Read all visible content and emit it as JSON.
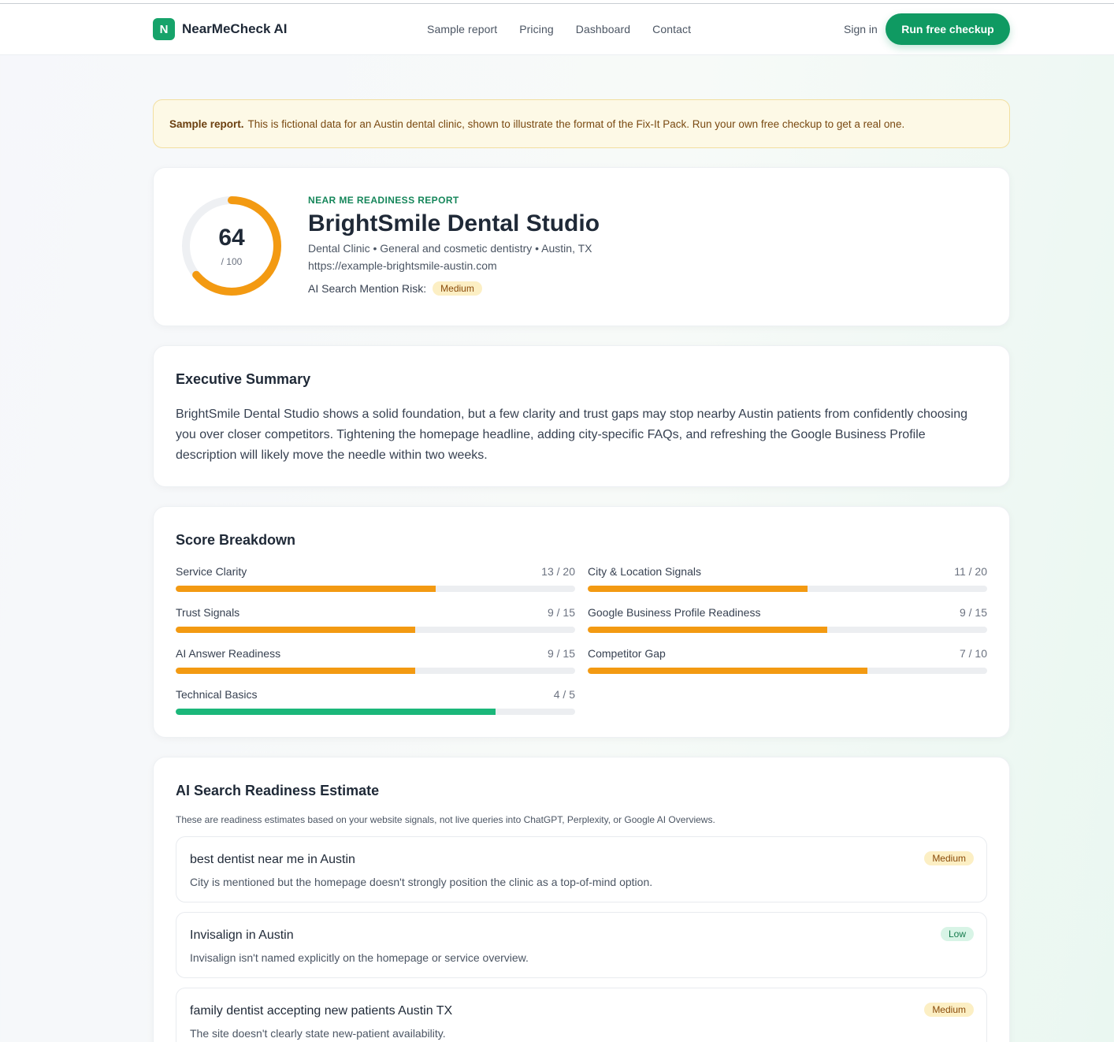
{
  "app": {
    "logo_letter": "N",
    "brand": "NearMeCheck AI"
  },
  "nav": {
    "items": [
      "Sample report",
      "Pricing",
      "Dashboard",
      "Contact"
    ],
    "signin": "Sign in",
    "cta": "Run free checkup"
  },
  "banner": {
    "strong": "Sample report.",
    "text": "This is fictional data for an Austin dental clinic, shown to illustrate the format of the Fix-It Pack. Run your own free checkup to get a real one."
  },
  "report": {
    "score": 64,
    "score_display": "64",
    "score_max": "/ 100",
    "eyebrow": "NEAR ME READINESS REPORT",
    "business_name": "BrightSmile Dental Studio",
    "meta": "Dental Clinic • General and cosmetic dentistry • Austin, TX",
    "url": "https://example-brightsmile-austin.com",
    "risk_label": "AI Search Mention Risk:",
    "risk_value": "Medium"
  },
  "summary": {
    "title": "Executive Summary",
    "text": "BrightSmile Dental Studio shows a solid foundation, but a few clarity and trust gaps may stop nearby Austin patients from confidently choosing you over closer competitors. Tightening the homepage headline, adding city-specific FAQs, and refreshing the Google Business Profile description will likely move the needle within two weeks."
  },
  "breakdown": {
    "title": "Score Breakdown",
    "metrics": [
      {
        "label": "Service Clarity",
        "value": "13 / 20",
        "score": 13,
        "max": 20
      },
      {
        "label": "City & Location Signals",
        "value": "11 / 20",
        "score": 11,
        "max": 20
      },
      {
        "label": "Trust Signals",
        "value": "9 / 15",
        "score": 9,
        "max": 15
      },
      {
        "label": "Google Business Profile Readiness",
        "value": "9 / 15",
        "score": 9,
        "max": 15
      },
      {
        "label": "AI Answer Readiness",
        "value": "9 / 15",
        "score": 9,
        "max": 15
      },
      {
        "label": "Competitor Gap",
        "value": "7 / 10",
        "score": 7,
        "max": 10
      },
      {
        "label": "Technical Basics",
        "value": "4 / 5",
        "score": 4,
        "max": 5
      }
    ]
  },
  "ai_search": {
    "title": "AI Search Readiness Estimate",
    "note": "These are readiness estimates based on your website signals, not live queries into ChatGPT, Perplexity, or Google AI Overviews.",
    "queries": [
      {
        "query": "best dentist near me in Austin",
        "desc": "City is mentioned but the homepage doesn't strongly position the clinic as a top-of-mind option.",
        "level": "Medium"
      },
      {
        "query": "Invisalign in Austin",
        "desc": "Invisalign isn't named explicitly on the homepage or service overview.",
        "level": "Low"
      },
      {
        "query": "family dentist accepting new patients Austin TX",
        "desc": "The site doesn't clearly state new-patient availability.",
        "level": "Medium"
      }
    ]
  },
  "colors": {
    "brand": "#0f9a62",
    "bar_warn": "#f39a12",
    "bar_good": "#1bb77a",
    "pill_medium_bg": "#fcefc4",
    "pill_low_bg": "#d8f4e6"
  }
}
